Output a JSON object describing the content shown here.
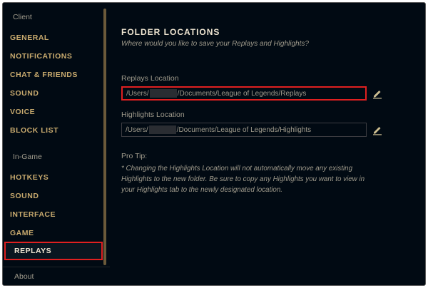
{
  "sidebar": {
    "client_header": "Client",
    "client_items": [
      {
        "label": "GENERAL"
      },
      {
        "label": "NOTIFICATIONS"
      },
      {
        "label": "CHAT & FRIENDS"
      },
      {
        "label": "SOUND"
      },
      {
        "label": "VOICE"
      },
      {
        "label": "BLOCK LIST"
      }
    ],
    "ingame_header": "In-Game",
    "ingame_items": [
      {
        "label": "HOTKEYS"
      },
      {
        "label": "SOUND"
      },
      {
        "label": "INTERFACE"
      },
      {
        "label": "GAME"
      }
    ],
    "selected_item": {
      "label": "REPLAYS"
    },
    "about": "About"
  },
  "main": {
    "title": "FOLDER LOCATIONS",
    "subtitle": "Where would you like to save your Replays and Highlights?",
    "replays": {
      "label": "Replays Location",
      "path_prefix": "/Users/",
      "path_suffix": "/Documents/League of Legends/Replays",
      "edit_icon": "pencil-icon"
    },
    "highlights": {
      "label": "Highlights Location",
      "path_prefix": "/Users/",
      "path_suffix": "/Documents/League of Legends/Highlights",
      "edit_icon": "pencil-icon"
    },
    "pro_tip_label": "Pro Tip:",
    "pro_tip_text": "* Changing the Highlights Location will not automatically move any existing Highlights to the new folder. Be sure to copy any Highlights you want to view in your Highlights tab to the newly designated location."
  },
  "colors": {
    "background": "#010a13",
    "gold": "#c8aa6e",
    "text_light": "#f0e6d2",
    "text_muted": "#a09b8c",
    "highlight_red": "#e02020"
  }
}
